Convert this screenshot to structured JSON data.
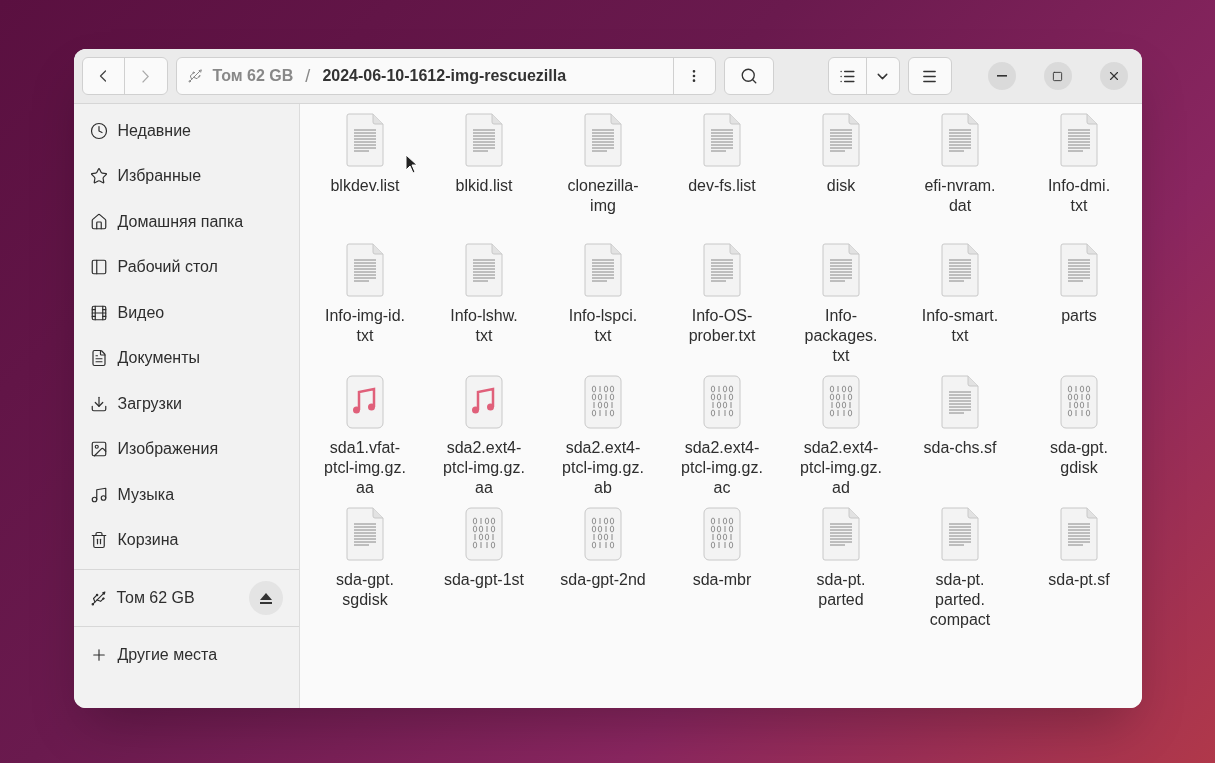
{
  "toolbar": {
    "back": {
      "disabled": false
    },
    "forward": {
      "disabled": true
    }
  },
  "path": {
    "location": "Том 62 GB",
    "separator": "/",
    "folder": "2024-06-10-1612-img-rescuezilla"
  },
  "sidebar": {
    "places": [
      {
        "label": "Недавние"
      },
      {
        "label": "Избранные"
      },
      {
        "label": "Домашняя папка"
      },
      {
        "label": "Рабочий стол"
      },
      {
        "label": "Видео"
      },
      {
        "label": "Документы"
      },
      {
        "label": "Загрузки"
      },
      {
        "label": "Изображения"
      },
      {
        "label": "Музыка"
      },
      {
        "label": "Корзина"
      }
    ],
    "devices": [
      {
        "label": "Том 62 GB"
      }
    ],
    "other": {
      "label": "Другие места"
    }
  },
  "files": [
    {
      "kind": "text",
      "name": "blkdev.list"
    },
    {
      "kind": "text",
      "name": "blkid.list"
    },
    {
      "kind": "text",
      "name": "clonezilla-\nimg"
    },
    {
      "kind": "text",
      "name": "dev-fs.list"
    },
    {
      "kind": "text",
      "name": "disk"
    },
    {
      "kind": "text",
      "name": "efi-nvram.\ndat"
    },
    {
      "kind": "text",
      "name": "Info-dmi.\ntxt"
    },
    {
      "kind": "text",
      "name": "Info-img-id.\ntxt"
    },
    {
      "kind": "text",
      "name": "Info-lshw.\ntxt"
    },
    {
      "kind": "text",
      "name": "Info-lspci.\ntxt"
    },
    {
      "kind": "text",
      "name": "Info-OS-\nprober.txt"
    },
    {
      "kind": "text",
      "name": "Info-\npackages.\ntxt"
    },
    {
      "kind": "text",
      "name": "Info-smart.\ntxt"
    },
    {
      "kind": "text",
      "name": "parts"
    },
    {
      "kind": "audio",
      "name": "sda1.vfat-\nptcl-img.gz.\naa"
    },
    {
      "kind": "audio",
      "name": "sda2.ext4-\nptcl-img.gz.\naa"
    },
    {
      "kind": "binary",
      "name": "sda2.ext4-\nptcl-img.gz.\nab"
    },
    {
      "kind": "binary",
      "name": "sda2.ext4-\nptcl-img.gz.\nac"
    },
    {
      "kind": "binary",
      "name": "sda2.ext4-\nptcl-img.gz.\nad"
    },
    {
      "kind": "text",
      "name": "sda-chs.sf"
    },
    {
      "kind": "binary",
      "name": "sda-gpt.\ngdisk"
    },
    {
      "kind": "text",
      "name": "sda-gpt.\nsgdisk"
    },
    {
      "kind": "binary",
      "name": "sda-gpt-1st"
    },
    {
      "kind": "binary",
      "name": "sda-gpt-2nd"
    },
    {
      "kind": "binary",
      "name": "sda-mbr"
    },
    {
      "kind": "text",
      "name": "sda-pt.\nparted"
    },
    {
      "kind": "text",
      "name": "sda-pt.\nparted.\ncompact"
    },
    {
      "kind": "text",
      "name": "sda-pt.sf"
    }
  ]
}
